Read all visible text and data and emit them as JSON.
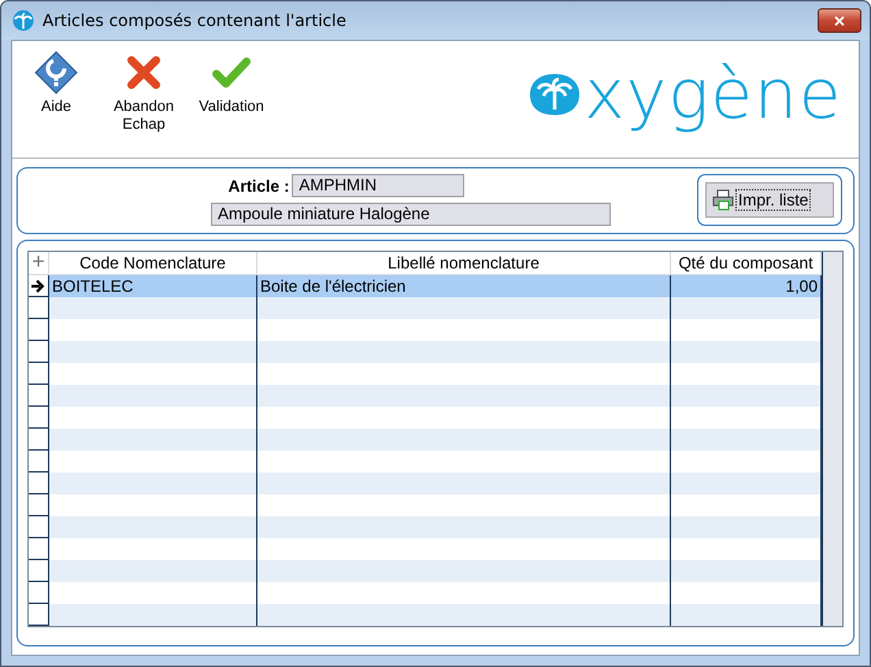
{
  "window": {
    "title": "Articles composés contenant l'article",
    "close": "×"
  },
  "toolbar": [
    {
      "kind": "help",
      "label": "Aide"
    },
    {
      "kind": "cancel",
      "label": "Abandon\nEchap"
    },
    {
      "kind": "ok",
      "label": "Validation"
    }
  ],
  "logo": {
    "text": "xygène"
  },
  "article": {
    "label": "Article :",
    "code": "AMPHMIN",
    "description": "Ampoule miniature Halogène"
  },
  "print_button": {
    "label": "Impr. liste"
  },
  "table": {
    "corner": "+",
    "columns": [
      "Code Nomenclature",
      "Libellé nomenclature",
      "Qté du composant"
    ],
    "rows": [
      {
        "selected": true,
        "cells": [
          "BOITELEC",
          "Boite de l'électricien",
          "1,00"
        ]
      }
    ]
  }
}
